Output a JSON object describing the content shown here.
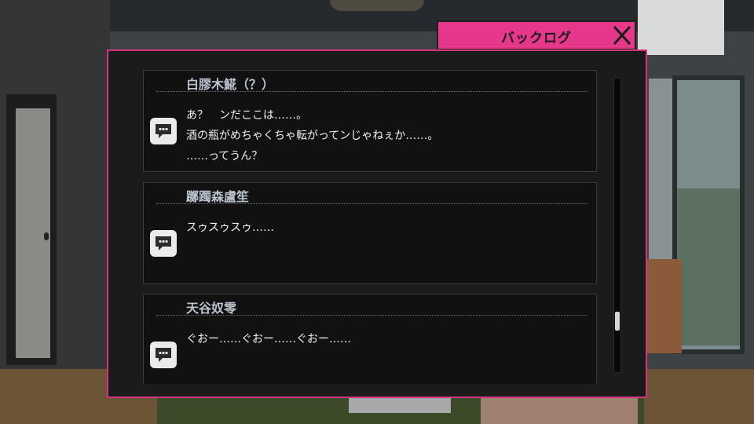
{
  "header": {
    "title": "バックログ",
    "close_icon": "close-icon"
  },
  "colors": {
    "accent": "#e6388a",
    "panel_border": "#d4357d",
    "name_color": "#b9c2cd"
  },
  "log": {
    "entries": [
      {
        "speaker": "白膠木𩸽（？）",
        "lines": [
          "あ？　ンだここは……。",
          "酒の瓶がめちゃくちゃ転がってンじゃねぇか……。",
          "……ってうん？"
        ],
        "voice_icon": "speech-bubble-icon"
      },
      {
        "speaker": "躑躅森盧笙",
        "lines": [
          "スゥスゥスゥ……"
        ],
        "voice_icon": "speech-bubble-icon"
      },
      {
        "speaker": "天谷奴零",
        "lines": [
          "ぐおー……ぐおー……ぐおー……"
        ],
        "voice_icon": "speech-bubble-icon"
      }
    ]
  },
  "scroll": {
    "position_fraction": 0.85
  }
}
